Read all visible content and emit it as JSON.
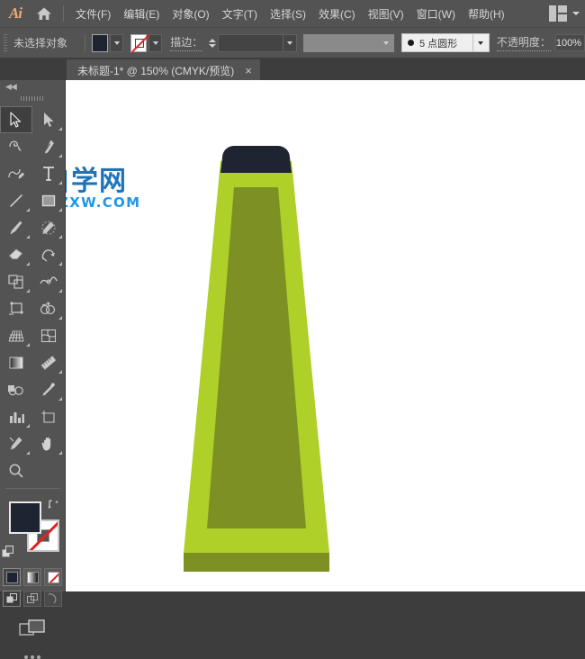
{
  "app": {
    "name": "Ai",
    "logo_icon": "illustrator-logo",
    "home_icon": "home-icon"
  },
  "menubar": {
    "items": [
      {
        "label": "文件(F)",
        "name": "menu-file"
      },
      {
        "label": "编辑(E)",
        "name": "menu-edit"
      },
      {
        "label": "对象(O)",
        "name": "menu-object"
      },
      {
        "label": "文字(T)",
        "name": "menu-type"
      },
      {
        "label": "选择(S)",
        "name": "menu-select"
      },
      {
        "label": "效果(C)",
        "name": "menu-effect"
      },
      {
        "label": "视图(V)",
        "name": "menu-view"
      },
      {
        "label": "窗口(W)",
        "name": "menu-window"
      },
      {
        "label": "帮助(H)",
        "name": "menu-help"
      }
    ],
    "workspace_icon": "workspace-grid-icon",
    "workspace_chevron": "chevron-down-icon"
  },
  "optionsbar": {
    "grip_icon": "drag-grip-icon",
    "selection_status": "未选择对象",
    "fill_swatch_color": "#1f2433",
    "fill_swatch_name": "fill-color-swatch",
    "stroke_swatch_name": "stroke-color-swatch",
    "stroke_swatch_value": "无",
    "stroke_label": "描边：",
    "stroke_weight_value": "",
    "stroke_profile_value": "",
    "brush_label": "5 点圆形",
    "brush_dot_icon": "round-brush-dot-icon",
    "opacity_label": "不透明度：",
    "opacity_value": "100%"
  },
  "tabbar": {
    "tab_title": "未标题-1* @ 150% (CMYK/预览)",
    "tab_close": "×"
  },
  "toolpanel": {
    "collapse_icon": "collapse-panel-icon",
    "collapse_label": "◀◀",
    "grip_icon": "panel-grip-icon",
    "tools": [
      {
        "name": "selection-tool",
        "label": "选择工具",
        "active": true,
        "corner": false
      },
      {
        "name": "direct-selection-tool",
        "label": "直接选择工具",
        "active": false,
        "corner": true
      },
      {
        "name": "magic-wand-tool",
        "label": "魔棒工具",
        "active": false,
        "corner": false
      },
      {
        "name": "pen-tool",
        "label": "钢笔工具",
        "active": false,
        "corner": true
      },
      {
        "name": "curvature-tool",
        "label": "曲率工具",
        "active": false,
        "corner": false
      },
      {
        "name": "type-tool",
        "label": "文字工具",
        "active": false,
        "corner": true
      },
      {
        "name": "line-segment-tool",
        "label": "直线段工具",
        "active": false,
        "corner": true
      },
      {
        "name": "rectangle-tool",
        "label": "矩形工具",
        "active": false,
        "corner": true
      },
      {
        "name": "paintbrush-tool",
        "label": "画笔工具",
        "active": false,
        "corner": true
      },
      {
        "name": "shaper-pencil-tool",
        "label": "Shaper 工具",
        "active": false,
        "corner": true
      },
      {
        "name": "eraser-tool",
        "label": "橡皮擦工具",
        "active": false,
        "corner": true
      },
      {
        "name": "rotate-tool",
        "label": "旋转工具",
        "active": false,
        "corner": true
      },
      {
        "name": "scale-tool",
        "label": "比例缩放工具",
        "active": false,
        "corner": true
      },
      {
        "name": "width-tool",
        "label": "宽度工具",
        "active": false,
        "corner": true
      },
      {
        "name": "free-transform-tool",
        "label": "自由变换工具",
        "active": false,
        "corner": false
      },
      {
        "name": "shape-builder-tool",
        "label": "形状生成器工具",
        "active": false,
        "corner": true
      },
      {
        "name": "perspective-grid-tool",
        "label": "透视网格工具",
        "active": false,
        "corner": true
      },
      {
        "name": "mesh-tool",
        "label": "网格工具",
        "active": false,
        "corner": false
      },
      {
        "name": "gradient-tool",
        "label": "渐变工具",
        "active": false,
        "corner": false
      },
      {
        "name": "measure-tool",
        "label": "度量工具",
        "active": false,
        "corner": true
      },
      {
        "name": "blend-tool",
        "label": "混合工具",
        "active": false,
        "corner": false
      },
      {
        "name": "eyedropper-tool",
        "label": "吸管工具",
        "active": false,
        "corner": true
      },
      {
        "name": "column-graph-tool",
        "label": "柱形图工具",
        "active": false,
        "corner": true
      },
      {
        "name": "artboard-tool",
        "label": "画板工具",
        "active": false,
        "corner": false
      },
      {
        "name": "slice-tool",
        "label": "切片工具",
        "active": false,
        "corner": true
      },
      {
        "name": "hand-tool",
        "label": "抓手工具",
        "active": false,
        "corner": true
      },
      {
        "name": "zoom-tool",
        "label": "缩放工具",
        "active": false,
        "corner": false
      }
    ],
    "fill_color": "#1f2433",
    "stroke_color": "无",
    "swap_icon": "swap-fill-stroke-icon",
    "default_colors_icon": "default-fill-stroke-icon",
    "fill_modes": [
      {
        "name": "color-mode-button",
        "label": "颜色",
        "selected": true
      },
      {
        "name": "gradient-mode-button",
        "label": "渐变",
        "selected": false
      },
      {
        "name": "none-mode-button",
        "label": "无",
        "selected": false
      }
    ],
    "draw_modes": [
      {
        "name": "draw-normal-button",
        "label": "正常绘图",
        "selected": true
      },
      {
        "name": "draw-behind-button",
        "label": "背面绘图",
        "selected": false
      },
      {
        "name": "draw-inside-button",
        "label": "内部绘图",
        "selected": false
      }
    ],
    "screen_mode_icon": "change-screen-mode-icon",
    "edit_toolbar_icon": "edit-toolbar-ellipsis-icon"
  },
  "canvas": {
    "background": "#ffffff",
    "watermark": {
      "chinese": "软件自学网",
      "url": "WWW.RJZXW.COM"
    },
    "artwork": {
      "name": "highlighter-marker-illustration",
      "cap_color": "#1f2433",
      "outer_color": "#aed028",
      "inner_color": "#7c9023",
      "base_color": "#7c9023"
    }
  }
}
